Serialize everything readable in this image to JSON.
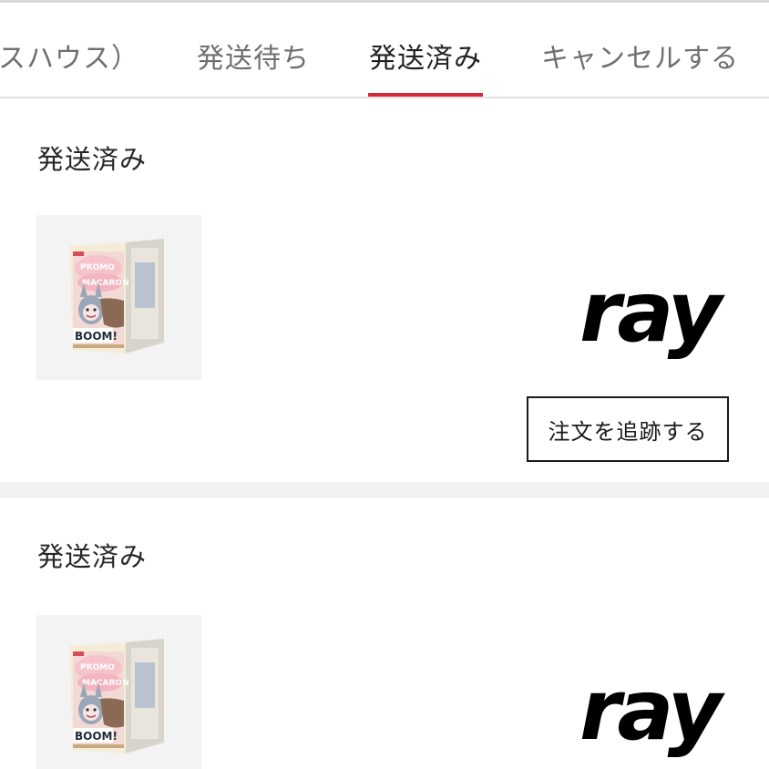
{
  "tabs": [
    {
      "label": "スハウス）",
      "active": false
    },
    {
      "label": "発送待ち",
      "active": false
    },
    {
      "label": "発送済み",
      "active": true
    },
    {
      "label": "キャンセルする",
      "active": false
    }
  ],
  "colors": {
    "accent": "#d62839",
    "separator": "#f2f2f2",
    "text": "#262626",
    "inactive_tab": "#6f6f6f"
  },
  "orders": [
    {
      "status": "発送済み",
      "product_image": "labubu-blind-box-image",
      "brand_logo": "ray",
      "track_button_label": "注文を追跡する"
    },
    {
      "status": "発送済み",
      "product_image": "labubu-blind-box-image",
      "brand_logo": "ray"
    }
  ]
}
